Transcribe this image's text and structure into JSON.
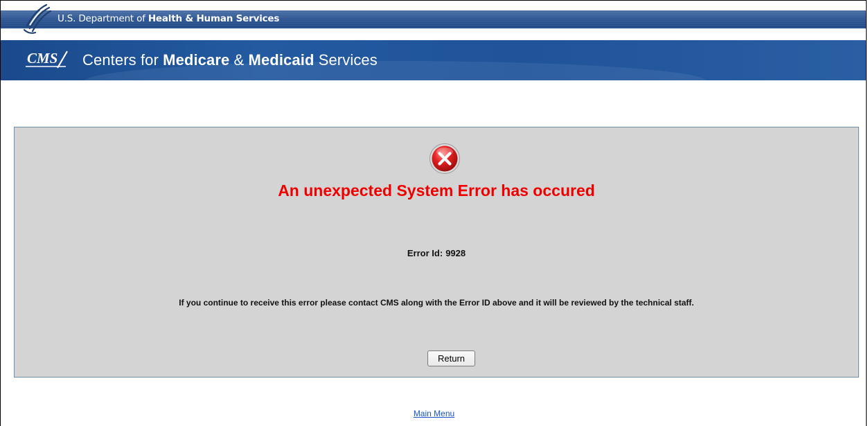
{
  "header": {
    "hhs": {
      "prefix": "U.S. Department of",
      "bold": "Health & Human Services",
      "logo_icon": "hhs-eagle-icon"
    },
    "cms": {
      "logo_text": "CMS",
      "title_light_1": "Centers for",
      "title_bold_1": "Medicare",
      "title_amp": "&",
      "title_bold_2": "Medicaid",
      "title_light_2": "Services"
    }
  },
  "error": {
    "icon": "error-x-icon",
    "heading": "An unexpected System Error has occured",
    "id_label": "Error Id:",
    "id_value": "9928",
    "message": "If you continue to receive this error please contact CMS along with the Error ID above and it will be reviewed by the technical staff.",
    "return_label": "Return"
  },
  "footer": {
    "main_menu_label": "Main Menu"
  },
  "colors": {
    "error_red": "#ee0000",
    "panel_gray": "#d4d4d4",
    "banner_blue": "#1f539a",
    "link_blue": "#1a53c9"
  }
}
